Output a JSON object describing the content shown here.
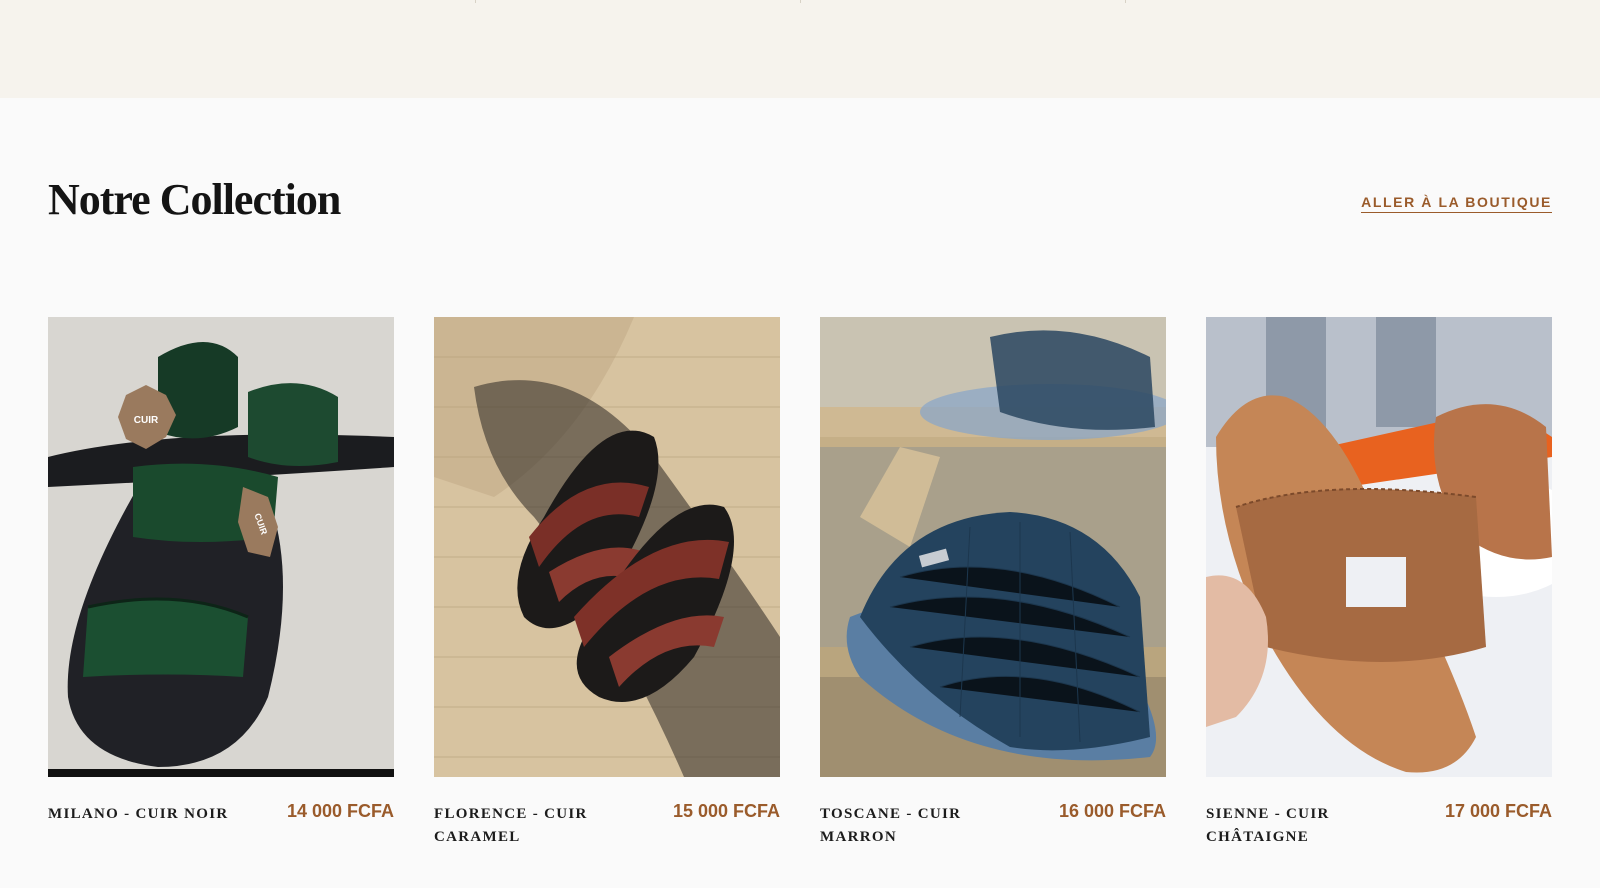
{
  "section": {
    "title": "Notre Collection",
    "shop_link": "ALLER À LA BOUTIQUE"
  },
  "colors": {
    "accent": "#9a5b2b",
    "title": "#141414",
    "band": "#f6f3ed"
  },
  "products": [
    {
      "name": "MILANO - CUIR NOIR",
      "price": "14 000 FCFA",
      "image_icon": "sandal-green-croc-photo",
      "badge_lines": [
        "CUIR",
        "CUIR"
      ]
    },
    {
      "name": "FLORENCE - CUIR CARAMEL",
      "price": "15 000 FCFA",
      "image_icon": "sandal-braided-burgundy-photo"
    },
    {
      "name": "TOSCANE - CUIR MARRON",
      "price": "16 000 FCFA",
      "image_icon": "slide-navy-croc-photo"
    },
    {
      "name": "SIENNE - CUIR CHÂTAIGNE",
      "price": "17 000 FCFA",
      "image_icon": "slide-tan-h-strap-photo"
    }
  ]
}
